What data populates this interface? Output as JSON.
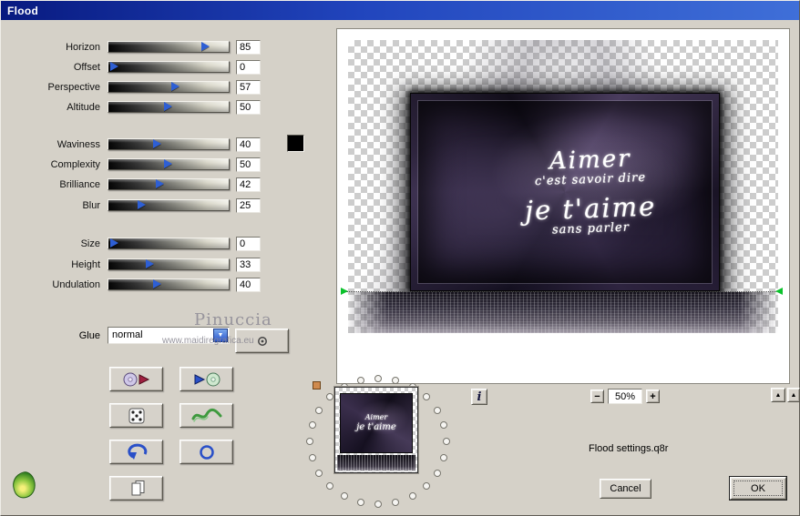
{
  "window": {
    "title": "Flood"
  },
  "sliders": {
    "items": [
      {
        "label": "Horizon",
        "value": 85
      },
      {
        "label": "Offset",
        "value": 0
      },
      {
        "label": "Perspective",
        "value": 57
      },
      {
        "label": "Altitude",
        "value": 50
      },
      {
        "label": "Waviness",
        "value": 40
      },
      {
        "label": "Complexity",
        "value": 50
      },
      {
        "label": "Brilliance",
        "value": 42
      },
      {
        "label": "Blur",
        "value": 25
      },
      {
        "label": "Size",
        "value": 0
      },
      {
        "label": "Height",
        "value": 33
      },
      {
        "label": "Undulation",
        "value": 40
      }
    ]
  },
  "glue": {
    "label": "Glue",
    "value": "normal"
  },
  "color_swatch": {
    "color": "#000000"
  },
  "watermark": {
    "name": "Pinuccia",
    "site": "www.maidiregrafica.eu"
  },
  "preview": {
    "artwork": {
      "lines": [
        "Aimer",
        "c'est savoir dire",
        "je t'aime",
        "sans parler"
      ]
    },
    "zoom": {
      "minus": "−",
      "value": "50%",
      "plus": "+"
    },
    "info": "i",
    "scroll_up": "▲"
  },
  "status": {
    "settings_file": "Flood settings.q8r"
  },
  "actions": {
    "cancel": "Cancel",
    "ok": "OK"
  }
}
